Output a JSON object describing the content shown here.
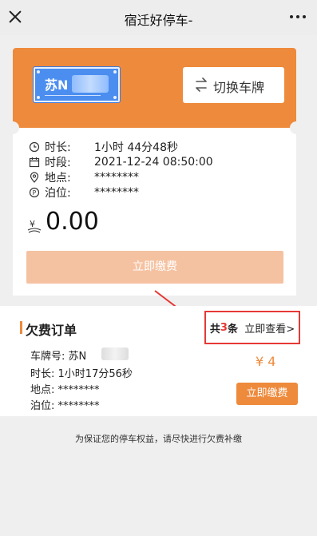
{
  "titlebar": {
    "title": "宿迁好停车-",
    "close_icon": "close-icon",
    "more_icon": "more-icon"
  },
  "plate_card": {
    "plate_prefix": "苏N",
    "switch_label": "切换车牌",
    "switch_icon": "swap-icon"
  },
  "parking_info": {
    "rows": [
      {
        "icon": "clock-icon",
        "label": "时长:",
        "value": "1小时 44分48秒"
      },
      {
        "icon": "calendar-icon",
        "label": "时段:",
        "value": "2021-12-24 08:50:00"
      },
      {
        "icon": "location-icon",
        "label": "地点:",
        "value": "********"
      },
      {
        "icon": "parking-icon",
        "label": "泊位:",
        "value": "********"
      }
    ],
    "amount": "0.00",
    "currency_icon": "yen-icon",
    "pay_label": "立即缴费"
  },
  "arrears": {
    "title": "欠费订单",
    "link_prefix": "共",
    "link_count": "3",
    "link_suffix": "条",
    "link_view": "立即查看>",
    "rows": [
      {
        "label": "车牌号:",
        "value": "苏N"
      },
      {
        "label": "时长:",
        "value": "1小时17分56秒"
      },
      {
        "label": "地点:",
        "value": "********"
      },
      {
        "label": "泊位:",
        "value": "********"
      }
    ],
    "amount": "¥ 4",
    "pay_label": "立即缴费"
  },
  "notice": "为保证您的停车权益，请尽快进行欠费补缴",
  "colors": {
    "accent": "#ee8a3c",
    "accent_light": "#f5c2a1",
    "plate_blue": "#4b8ef0",
    "highlight_red": "#e53935"
  }
}
